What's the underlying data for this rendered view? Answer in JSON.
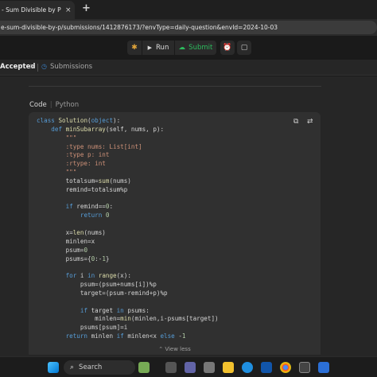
{
  "browser": {
    "tab_title": "- Sum Divisible by P - Leet",
    "tab_close": "×",
    "new_tab": "+",
    "url": "e-sum-divisible-by-p/submissions/1412876173/?envType=daily-question&envId=2024-10-03"
  },
  "toolbar": {
    "run_label": "Run",
    "submit_label": "Submit"
  },
  "panel": {
    "accepted_tab": "Accepted",
    "close": "×",
    "submissions_tab": "Submissions"
  },
  "code_header": {
    "label": "Code",
    "separator": "|",
    "language": "Python"
  },
  "code": {
    "lines": [
      "class Solution(object):",
      "    def minSubarray(self, nums, p):",
      "        \"\"\"",
      "        :type nums: List[int]",
      "        :type p: int",
      "        :rtype: int",
      "        \"\"\"",
      "        totalsum=sum(nums)",
      "        remind=totalsum%p",
      "",
      "        if remind==0:",
      "            return 0",
      "",
      "        x=len(nums)",
      "        minlen=x",
      "        psum=0",
      "        psums={0:-1}",
      "",
      "        for i in range(x):",
      "            psum=(psum+nums[i])%p",
      "            target=(psum-remind+p)%p",
      "",
      "            if target in psums:",
      "                minlen=min(minlen,i-psums[target])",
      "            psums[psum]=i",
      "        return minlen if minlen<x else -1"
    ],
    "view_less": "View less"
  },
  "taskbar": {
    "search_label": "Search"
  },
  "icons": {
    "debug": "bug-icon",
    "run": "play-icon",
    "submit": "cloud-upload-icon",
    "timer": "alarm-icon",
    "note": "note-icon",
    "copy": "copy-icon",
    "wrap": "wrap-icon",
    "submissions": "history-icon"
  },
  "colors": {
    "accent_green": "#2cbb5d",
    "keyword_blue": "#569cd6",
    "function_yellow": "#dcdcaa",
    "string_orange": "#ce9178"
  }
}
